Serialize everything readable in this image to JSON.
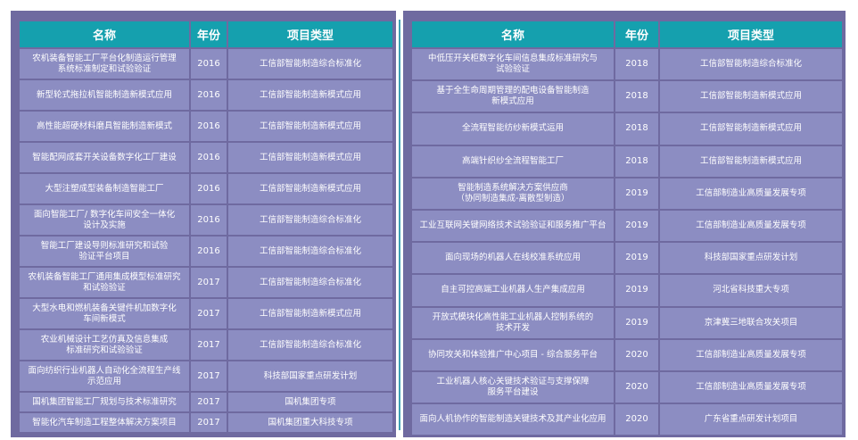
{
  "left_table": {
    "headers": [
      "名称",
      "年份",
      "项目类型"
    ],
    "rows": [
      {
        "name": "农机装备智能工厂平台化制造运行管理\n系统标准制定和试验验证",
        "year": "2016",
        "type": "工信部智能制造综合标准化"
      },
      {
        "name": "新型轮式拖拉机智能制造新模式应用",
        "year": "2016",
        "type": "工信部智能制造新模式应用"
      },
      {
        "name": "高性能超硬材料磨具智能制造新模式",
        "year": "2016",
        "type": "工信部智能制造新模式应用"
      },
      {
        "name": "智能配网成套开关设备数字化工厂建设",
        "year": "2016",
        "type": "工信部智能制造新模式应用"
      },
      {
        "name": "大型注塑成型装备制造智能工厂",
        "year": "2016",
        "type": "工信部智能制造新模式应用"
      },
      {
        "name": "面向智能工厂/ 数字化车间安全一体化\n设计及实施",
        "year": "2016",
        "type": "工信部智能制造综合标准化"
      },
      {
        "name": "智能工厂建设导则标准研究和试验\n验证平台项目",
        "year": "2016",
        "type": "工信部智能制造综合标准化"
      },
      {
        "name": "农机装备智能工厂通用集成模型标准研究\n和试验验证",
        "year": "2017",
        "type": "工信部智能制造综合标准化"
      },
      {
        "name": "大型水电和燃机装备关键件机加数字化\n车间新模式",
        "year": "2017",
        "type": "工信部智能制造新模式应用"
      },
      {
        "name": "农业机械设计工艺仿真及信息集成\n标准研究和试验验证",
        "year": "2017",
        "type": "工信部智能制造综合标准化"
      },
      {
        "name": "面向纺织行业机器人自动化全流程生产线\n示范应用",
        "year": "2017",
        "type": "科技部国家重点研发计划"
      },
      {
        "name": "国机集团智能工厂规划与技术标准研究",
        "year": "2017",
        "type": "国机集团专项"
      },
      {
        "name": "智能化汽车制造工程整体解决方案项目",
        "year": "2017",
        "type": "国机集团重大科技专项"
      }
    ]
  },
  "right_table": {
    "headers": [
      "名称",
      "年份",
      "项目类型"
    ],
    "rows": [
      {
        "name": "中低压开关柜数字化车间信息集成标准研究与\n试验验证",
        "year": "2018",
        "type": "工信部智能制造综合标准化"
      },
      {
        "name": "基于全生命周期管理的配电设备智能制造\n新模式应用",
        "year": "2018",
        "type": "工信部智能制造新模式应用"
      },
      {
        "name": "全流程智能纺纱新模式运用",
        "year": "2018",
        "type": "工信部智能制造新模式应用"
      },
      {
        "name": "高端针织纱全流程智能工厂",
        "year": "2018",
        "type": "工信部智能制造新模式应用"
      },
      {
        "name": "智能制造系统解决方案供应商\n（协同制造集成-离散型制造）",
        "year": "2019",
        "type": "工信部制造业高质量发展专项"
      },
      {
        "name": "工业互联网关键网络技术试验验证和服务推广平台",
        "year": "2019",
        "type": "工信部制造业高质量发展专项"
      },
      {
        "name": "面向现场的机器人在线校准系统应用",
        "year": "2019",
        "type": "科技部国家重点研发计划"
      },
      {
        "name": "自主可控高端工业机器人生产集成应用",
        "year": "2019",
        "type": "河北省科技重大专项"
      },
      {
        "name": "开放式模块化高性能工业机器人控制系统的\n技术开发",
        "year": "2019",
        "type": "京津冀三地联合攻关项目"
      },
      {
        "name": "协同攻关和体验推广中心项目 - 综合服务平台",
        "year": "2020",
        "type": "工信部制造业高质量发展专项"
      },
      {
        "name": "工业机器人核心关键技术验证与支撑保障\n服务平台建设",
        "year": "2020",
        "type": "工信部制造业高质量发展专项"
      },
      {
        "name": "面向人机协作的智能制造关键技术及其产业化应用",
        "year": "2020",
        "type": "广东省重点研发计划项目"
      }
    ]
  }
}
